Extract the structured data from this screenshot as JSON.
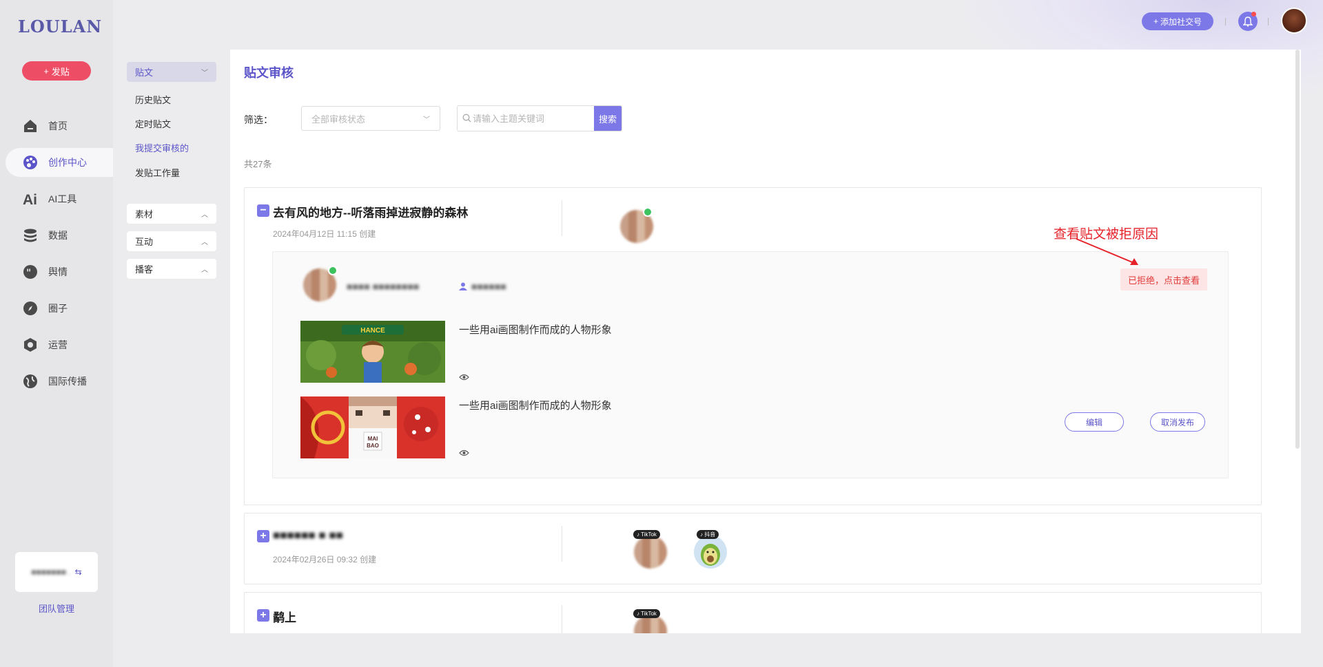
{
  "brand": {
    "logo": "LOULAN",
    "post_button": "发贴"
  },
  "nav": {
    "items": [
      {
        "label": "首页",
        "icon": "home-icon"
      },
      {
        "label": "创作中心",
        "icon": "palette-icon",
        "active": true
      },
      {
        "label": "AI工具",
        "icon": "ai-icon"
      },
      {
        "label": "数据",
        "icon": "database-icon"
      },
      {
        "label": "舆情",
        "icon": "quote-icon"
      },
      {
        "label": "圈子",
        "icon": "compass-icon"
      },
      {
        "label": "运营",
        "icon": "operation-icon"
      },
      {
        "label": "国际传播",
        "icon": "globe-icon"
      }
    ],
    "team_manage": "团队管理"
  },
  "subnav": {
    "groups": [
      {
        "label": "贴文",
        "open": true
      },
      {
        "label": "素材"
      },
      {
        "label": "互动"
      },
      {
        "label": "播客"
      }
    ],
    "items": [
      {
        "label": "历史贴文"
      },
      {
        "label": "定时贴文"
      },
      {
        "label": "我提交审核的",
        "active": true
      },
      {
        "label": "发贴工作量"
      }
    ]
  },
  "header": {
    "add_social": "添加社交号"
  },
  "main": {
    "title": "贴文审核",
    "filter_label": "筛选：",
    "status_placeholder": "全部审核状态",
    "search_placeholder": "请输入主题关键词",
    "search_button": "搜索",
    "total": "共27条"
  },
  "posts": [
    {
      "title": "去有风的地方--听落雨掉进寂静的森林",
      "date": "2024年04月12日 11:15 创建",
      "rejected_label": "已拒绝，点击查看",
      "media": [
        {
          "desc": "一些用ai画图制作而成的人物形象",
          "thumb_text": "HANCE"
        },
        {
          "desc": "一些用ai画图制作而成的人物形象",
          "thumb_text": "MAI BAO"
        }
      ],
      "edit_button": "编辑",
      "unpublish_button": "取消发布"
    },
    {
      "title": "",
      "date": "2024年02月26日 09:32 创建",
      "platforms": [
        "TikTok",
        "抖音"
      ]
    },
    {
      "title": "鹬上",
      "platforms": [
        "TikTok"
      ]
    }
  ],
  "annotation": "查看贴文被拒原因",
  "colors": {
    "accent": "#7c78e8",
    "brand": "#5b55c9",
    "danger": "#ee4d66",
    "reject": "#e13a3a"
  }
}
